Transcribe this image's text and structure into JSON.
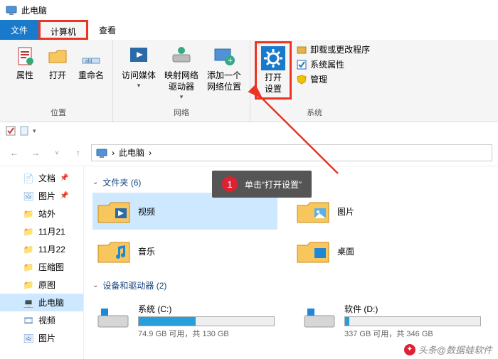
{
  "titlebar": {
    "title": "此电脑"
  },
  "tabs": {
    "file": "文件",
    "computer": "计算机",
    "view": "查看"
  },
  "ribbon": {
    "group_location": "位置",
    "group_network": "网络",
    "group_system": "系统",
    "btn_properties": "属性",
    "btn_open": "打开",
    "btn_rename": "重命名",
    "btn_media": "访问媒体",
    "btn_map_drive": "映射网络\n驱动器",
    "btn_add_netloc": "添加一个\n网络位置",
    "btn_open_settings": "打开\n设置",
    "side_uninstall": "卸载或更改程序",
    "side_sys_props": "系统属性",
    "side_manage": "管理"
  },
  "address": {
    "root": "此电脑",
    "sep": "›"
  },
  "sidebar": {
    "items": [
      {
        "label": "文档",
        "pinned": true,
        "glyph": "📄",
        "color": "#6ea0d6"
      },
      {
        "label": "图片",
        "pinned": true,
        "glyph": "🖼",
        "color": "#6ea0d6"
      },
      {
        "label": "站外",
        "pinned": false,
        "glyph": "📁",
        "color": "#f7c65c"
      },
      {
        "label": "11月21",
        "pinned": false,
        "glyph": "📁",
        "color": "#f7c65c"
      },
      {
        "label": "11月22",
        "pinned": false,
        "glyph": "📁",
        "color": "#f7c65c"
      },
      {
        "label": "压缩图",
        "pinned": false,
        "glyph": "📁",
        "color": "#f7c65c"
      },
      {
        "label": "原图",
        "pinned": false,
        "glyph": "📁",
        "color": "#f7c65c"
      },
      {
        "label": "此电脑",
        "pinned": false,
        "glyph": "💻",
        "color": "#5a8bc8",
        "active": true
      },
      {
        "label": "视频",
        "pinned": false,
        "glyph": "🎞",
        "color": "#5a8bc8"
      },
      {
        "label": "图片",
        "pinned": false,
        "glyph": "🖼",
        "color": "#5a8bc8"
      }
    ]
  },
  "main": {
    "folders_header": "文件夹 (6)",
    "folders": [
      {
        "label": "视频",
        "selected": true
      },
      {
        "label": "图片",
        "selected": false
      },
      {
        "label": "音乐",
        "selected": false
      },
      {
        "label": "桌面",
        "selected": false
      }
    ],
    "drives_header": "设备和驱动器 (2)",
    "drives": [
      {
        "label": "系统 (C:)",
        "sub": "74.9 GB 可用，共 130 GB",
        "fill": 42
      },
      {
        "label": "软件 (D:)",
        "sub": "337 GB 可用，共 346 GB",
        "fill": 3
      }
    ]
  },
  "tooltip": {
    "num": "1",
    "text": "单击“打开设置”"
  },
  "watermark": "头条@数据蛙软件"
}
